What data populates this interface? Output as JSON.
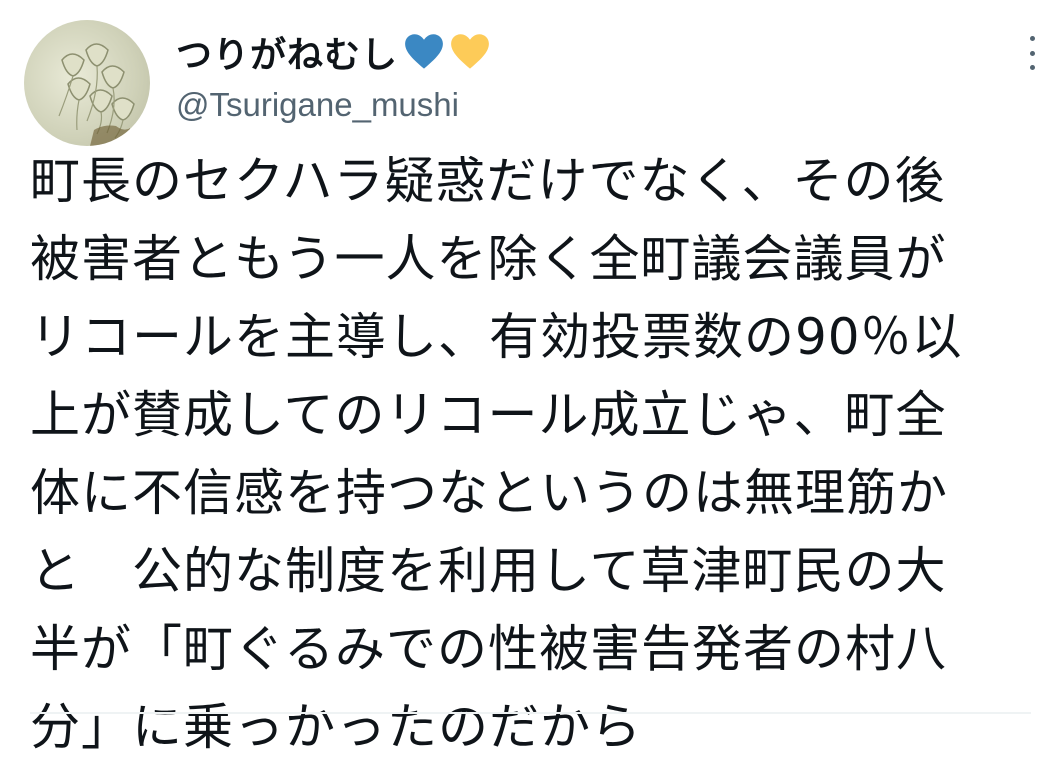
{
  "user": {
    "display_name": "つりがねむし",
    "handle": "@Tsurigane_mushi",
    "avatar_icon": "vorticella-avatar",
    "heart_emojis": [
      "blue-heart-icon",
      "yellow-heart-icon"
    ],
    "heart_colors": [
      "#3b88c3",
      "#fdcb58"
    ]
  },
  "tweet": {
    "lines": [
      "町長のセクハラ疑惑だけでなく、その後",
      "被害者ともう一人を除く全町議会議員が",
      "リコールを主導し、有効投票数の90％以",
      "上が賛成してのリコール成立じゃ、町全",
      "体に不信感を持つなというのは無理筋か",
      "と　公的な制度を利用して草津町民の大",
      "半が「町ぐるみでの性被害告発者の村八",
      "分」に乗っかったのだから"
    ]
  },
  "colors": {
    "text": "#0f1419",
    "secondary": "#536471"
  }
}
